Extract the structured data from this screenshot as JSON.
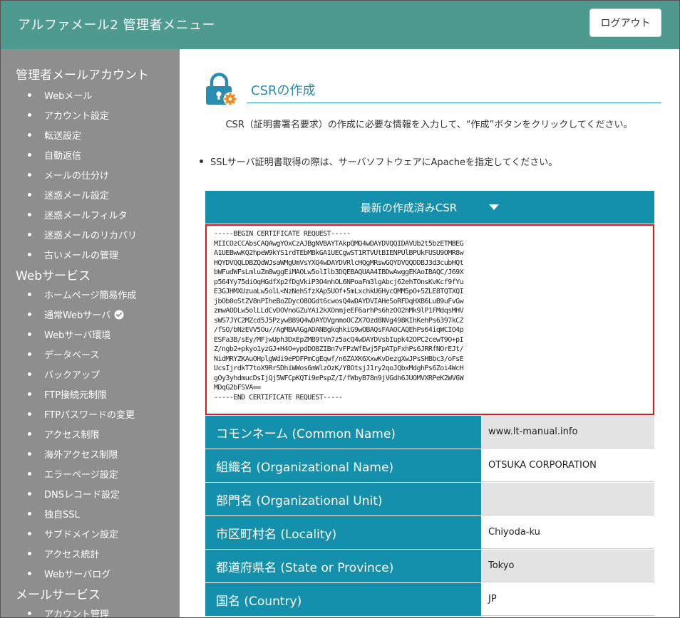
{
  "header": {
    "title": "アルファメール2 管理者メニュー",
    "logout_label": "ログアウト"
  },
  "sidebar": {
    "sections": [
      {
        "title": "管理者メールアカウント",
        "items": [
          "Webメール",
          "アカウント設定",
          "転送設定",
          "自動返信",
          "メールの仕分け",
          "迷惑メール設定",
          "迷惑メールフィルタ",
          "迷惑メールのリカバリ",
          "古いメールの管理"
        ]
      },
      {
        "title": "Webサービス",
        "items": [
          "ホームページ簡易作成",
          "通常Webサーバ",
          "Webサーバ環境",
          "データベース",
          "バックアップ",
          "FTP接続元制限",
          "FTPパスワードの変更",
          "アクセス制限",
          "海外アクセス制限",
          "エラーページ設定",
          "DNSレコード設定",
          "独自SSL",
          "サブドメイン設定",
          "アクセス統計",
          "Webサーバログ"
        ]
      },
      {
        "title": "メールサービス",
        "items": [
          "アカウント管理"
        ]
      }
    ]
  },
  "main": {
    "title": "CSRの作成",
    "instruction": "CSR（証明書署名要求）の作成に必要な情報を入力して、“作成”ボタンをクリックしてください。",
    "note": "SSLサーバ証明書取得の際は、サーバソフトウェアにApacheを指定してください。",
    "csr_section_label": "最新の作成済みCSR",
    "csr_text": "-----BEGIN CERTIFICATE REQUEST-----\nMIICOzCCAbsCAQAwgYOxCzAJBgNVBAYTAkpQMQ4wDAYDVQQIDAVUb2t5bzETMBEG\nA1UEBwwKQ2hpeW9kYS1rdTEbMBkGA1UECgwST1RTVUtBIENPUlBPUkFUSU9OMR8w\nHQYDVQQLDBZQdWJsaWMgUmVsYXQ4wDAYDVRlcHQgMRswGQYDVQQDDBJ3d3cubHQt\nbWFudWFsLmluZm8wggEiMAOLw5olIlb3DQEBAQUAA4IBDwAwggEKAoIBAQC/J69X\np564Yy75diOqHGdfXp2fDgVkiP3O4nhOL6NPoaFm3lgAbcj62ehTOnsKvKcf9fYu\nE3GJHMXUzuaLw5olL<NzNehSfzXAp5UOf+5mLxchkU6HycQMM5pO+5ZLE8TQTXQI\njbOb0oStZV8nPIheBoZDycO8OGdt6cwosQ4wDAYDVIAHeSoRFDqHXB6LuB9uFvGw\nzmwAODLw5olLLdCvDOVnoGZuYAi2kXOnmjeEF6arhPs6hzOO2hMk9lP1FMdqsMHV\nsWS7JYC2MZcd5J5PzywB89Q4wDAYDVgnmoOCZX7Ozd8NVg498KIhKehPs6397kCZ\n/fSO/bNzEVV5Ou//AgMBAAGgADANBgkqhkiG9wOBAQsFAAOCAQEhPs64iqWCIO4p\nESFa3B/sEy/MFjwUph3DxEpZMB9tVn7z5acQ4wDAYDVsbIupk42OPC2cewT9O+pI\nZ/ngb2+pkyo1yzGJ+H4O+ypdDO8ZIBn7vFPzWfEwj5FpATpFxhPs6JRRfNOrEJt/\nNidMRYZKAuOHplgWdi9ePDFPmCgEqwf/n6ZAXK6XxwKvDezgXwJPsSHBbc3/oFsE\nUcsIjrdkT7toX9RrSDhiWWos6mWlzOzK/Y8OtsjJ1ry2qoJQbxMdghPs6Zoi4WcH\ngOy3yhdmucDsIjQj5WFCpKQTi9ePspZ/I/fWbyB78n9jVGdh6JUOMVXRPeK2WV6W\nMDqG2bFSVA==\n-----END CERTIFICATE REQUEST-----",
    "fields": [
      {
        "label": "コモンネーム (Common Name)",
        "value": "www.lt-manual.info"
      },
      {
        "label": "組織名 (Organizational Name)",
        "value": "OTSUKA CORPORATION"
      },
      {
        "label": "部門名 (Organizational Unit)",
        "value": ""
      },
      {
        "label": "市区町村名 (Locality)",
        "value": "Chiyoda-ku"
      },
      {
        "label": "都道府県名 (State or Province)",
        "value": "Tokyo"
      },
      {
        "label": "国名 (Country)",
        "value": "JP"
      }
    ]
  },
  "colors": {
    "header_bg": "#4e9a8e",
    "sidebar_bg": "#8e8e8e",
    "accent": "#1590ac",
    "title": "#2a8db0",
    "highlight_border": "#e01818"
  }
}
